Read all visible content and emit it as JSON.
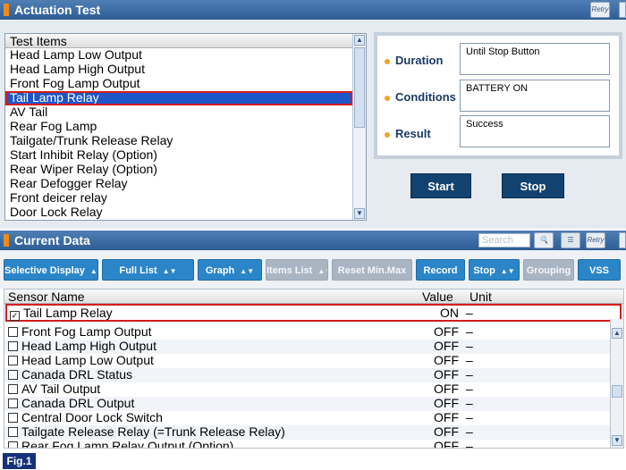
{
  "actuation": {
    "title": "Actuation Test",
    "retry_icon": "retry-icon",
    "test_items_header": "Test Items",
    "test_items": [
      "Head Lamp Low Output",
      "Head Lamp High Output",
      "Front Fog Lamp Output",
      "Tail Lamp Relay",
      "AV Tail",
      "Rear Fog Lamp",
      "Tailgate/Trunk Release Relay",
      "Start Inhibit Relay (Option)",
      "Rear Wiper Relay (Option)",
      "Rear Defogger Relay",
      "Front deicer relay",
      "Door Lock Relay"
    ],
    "selected_index": 3,
    "duration_label": "Duration",
    "duration_value": "Until Stop Button",
    "conditions_label": "Conditions",
    "conditions_value": "BATTERY ON",
    "result_label": "Result",
    "result_value": "Success",
    "start_label": "Start",
    "stop_label": "Stop"
  },
  "current_data": {
    "title": "Current Data",
    "search_placeholder": "Search",
    "toolbar": {
      "selective_display": "Selective Display",
      "full_list": "Full List",
      "graph": "Graph",
      "items_list": "Items List",
      "reset_min_max": "Reset Min.Max",
      "record": "Record",
      "stop": "Stop",
      "grouping": "Grouping",
      "vss": "VSS"
    },
    "columns": {
      "sensor": "Sensor Name",
      "value": "Value",
      "unit": "Unit"
    },
    "pinned_row": {
      "name": "Tail Lamp Relay",
      "value": "ON",
      "unit": "–",
      "checked": "☑"
    },
    "rows": [
      {
        "name": "Front Fog Lamp Output",
        "value": "OFF",
        "unit": "–"
      },
      {
        "name": "Head Lamp High Output",
        "value": "OFF",
        "unit": "–"
      },
      {
        "name": "Head Lamp Low Output",
        "value": "OFF",
        "unit": "–"
      },
      {
        "name": "Canada DRL Status",
        "value": "OFF",
        "unit": "–"
      },
      {
        "name": "AV Tail Output",
        "value": "OFF",
        "unit": "–"
      },
      {
        "name": "Canada DRL Output",
        "value": "OFF",
        "unit": "–"
      },
      {
        "name": "Central Door Lock Switch",
        "value": "OFF",
        "unit": "–"
      },
      {
        "name": "Tailgate Release Relay (=Trunk Release Relay)",
        "value": "OFF",
        "unit": "–"
      },
      {
        "name": "Rear Fog Lamp Relay Output (Option)",
        "value": "OFF",
        "unit": "–"
      }
    ]
  },
  "figure_label": "Fig.1",
  "colors": {
    "title_bar": "#2e5d95",
    "selection": "#1d56c8",
    "highlight_border": "#d11e1e",
    "toolbar_button": "#2b85c9",
    "action_button": "#12426f"
  }
}
